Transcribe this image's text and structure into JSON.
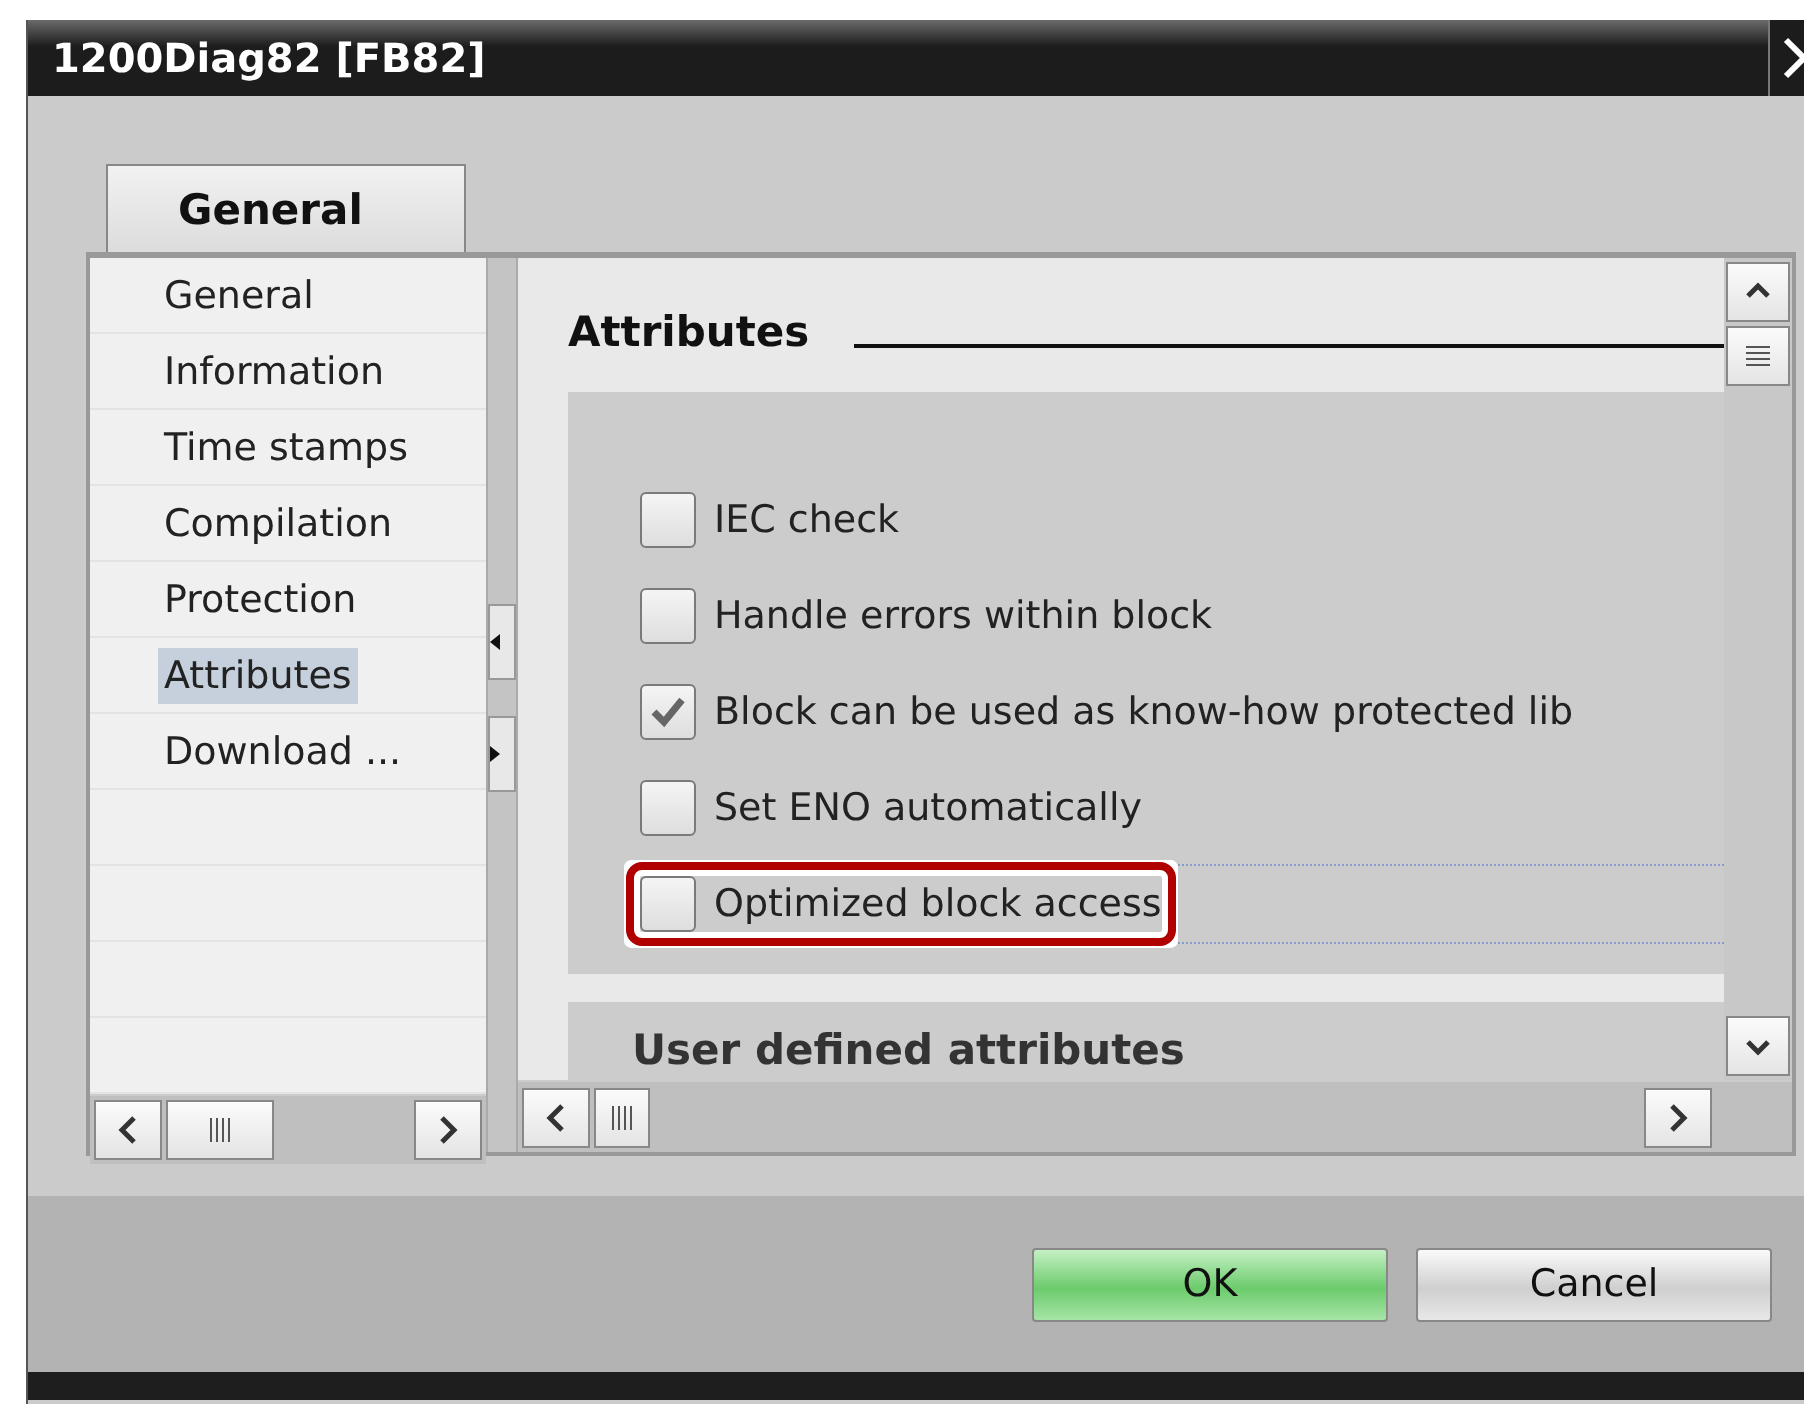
{
  "window": {
    "title": "1200Diag82 [FB82]"
  },
  "tabs": [
    {
      "label": "General",
      "selected": true
    }
  ],
  "sidebar": {
    "items": [
      {
        "label": "General",
        "selected": false
      },
      {
        "label": "Information",
        "selected": false
      },
      {
        "label": "Time stamps",
        "selected": false
      },
      {
        "label": "Compilation",
        "selected": false
      },
      {
        "label": "Protection",
        "selected": false
      },
      {
        "label": "Attributes",
        "selected": true
      },
      {
        "label": "Download ...",
        "selected": false
      }
    ]
  },
  "section": {
    "title": "Attributes",
    "options": [
      {
        "label": "IEC check",
        "checked": false,
        "highlighted": false
      },
      {
        "label": "Handle errors within block",
        "checked": false,
        "highlighted": false
      },
      {
        "label": "Block can be used as know-how protected lib",
        "checked": true,
        "highlighted": false
      },
      {
        "label": "Set ENO automatically",
        "checked": false,
        "highlighted": false
      },
      {
        "label": "Optimized block access",
        "checked": false,
        "highlighted": true
      }
    ]
  },
  "next_section": {
    "title": "User defined attributes"
  },
  "buttons": [
    {
      "label": "OK",
      "kind": "primary"
    },
    {
      "label": "Cancel",
      "kind": "normal"
    }
  ]
}
